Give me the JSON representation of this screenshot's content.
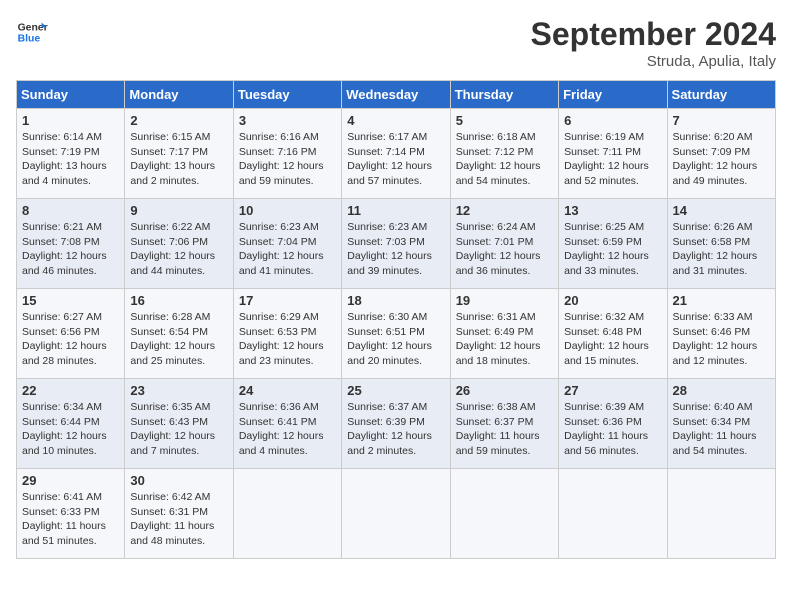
{
  "logo": {
    "text_general": "General",
    "text_blue": "Blue"
  },
  "header": {
    "month": "September 2024",
    "location": "Struda, Apulia, Italy"
  },
  "weekdays": [
    "Sunday",
    "Monday",
    "Tuesday",
    "Wednesday",
    "Thursday",
    "Friday",
    "Saturday"
  ],
  "weeks": [
    [
      {
        "day": "1",
        "info": "Sunrise: 6:14 AM\nSunset: 7:19 PM\nDaylight: 13 hours\nand 4 minutes."
      },
      {
        "day": "2",
        "info": "Sunrise: 6:15 AM\nSunset: 7:17 PM\nDaylight: 13 hours\nand 2 minutes."
      },
      {
        "day": "3",
        "info": "Sunrise: 6:16 AM\nSunset: 7:16 PM\nDaylight: 12 hours\nand 59 minutes."
      },
      {
        "day": "4",
        "info": "Sunrise: 6:17 AM\nSunset: 7:14 PM\nDaylight: 12 hours\nand 57 minutes."
      },
      {
        "day": "5",
        "info": "Sunrise: 6:18 AM\nSunset: 7:12 PM\nDaylight: 12 hours\nand 54 minutes."
      },
      {
        "day": "6",
        "info": "Sunrise: 6:19 AM\nSunset: 7:11 PM\nDaylight: 12 hours\nand 52 minutes."
      },
      {
        "day": "7",
        "info": "Sunrise: 6:20 AM\nSunset: 7:09 PM\nDaylight: 12 hours\nand 49 minutes."
      }
    ],
    [
      {
        "day": "8",
        "info": "Sunrise: 6:21 AM\nSunset: 7:08 PM\nDaylight: 12 hours\nand 46 minutes."
      },
      {
        "day": "9",
        "info": "Sunrise: 6:22 AM\nSunset: 7:06 PM\nDaylight: 12 hours\nand 44 minutes."
      },
      {
        "day": "10",
        "info": "Sunrise: 6:23 AM\nSunset: 7:04 PM\nDaylight: 12 hours\nand 41 minutes."
      },
      {
        "day": "11",
        "info": "Sunrise: 6:23 AM\nSunset: 7:03 PM\nDaylight: 12 hours\nand 39 minutes."
      },
      {
        "day": "12",
        "info": "Sunrise: 6:24 AM\nSunset: 7:01 PM\nDaylight: 12 hours\nand 36 minutes."
      },
      {
        "day": "13",
        "info": "Sunrise: 6:25 AM\nSunset: 6:59 PM\nDaylight: 12 hours\nand 33 minutes."
      },
      {
        "day": "14",
        "info": "Sunrise: 6:26 AM\nSunset: 6:58 PM\nDaylight: 12 hours\nand 31 minutes."
      }
    ],
    [
      {
        "day": "15",
        "info": "Sunrise: 6:27 AM\nSunset: 6:56 PM\nDaylight: 12 hours\nand 28 minutes."
      },
      {
        "day": "16",
        "info": "Sunrise: 6:28 AM\nSunset: 6:54 PM\nDaylight: 12 hours\nand 25 minutes."
      },
      {
        "day": "17",
        "info": "Sunrise: 6:29 AM\nSunset: 6:53 PM\nDaylight: 12 hours\nand 23 minutes."
      },
      {
        "day": "18",
        "info": "Sunrise: 6:30 AM\nSunset: 6:51 PM\nDaylight: 12 hours\nand 20 minutes."
      },
      {
        "day": "19",
        "info": "Sunrise: 6:31 AM\nSunset: 6:49 PM\nDaylight: 12 hours\nand 18 minutes."
      },
      {
        "day": "20",
        "info": "Sunrise: 6:32 AM\nSunset: 6:48 PM\nDaylight: 12 hours\nand 15 minutes."
      },
      {
        "day": "21",
        "info": "Sunrise: 6:33 AM\nSunset: 6:46 PM\nDaylight: 12 hours\nand 12 minutes."
      }
    ],
    [
      {
        "day": "22",
        "info": "Sunrise: 6:34 AM\nSunset: 6:44 PM\nDaylight: 12 hours\nand 10 minutes."
      },
      {
        "day": "23",
        "info": "Sunrise: 6:35 AM\nSunset: 6:43 PM\nDaylight: 12 hours\nand 7 minutes."
      },
      {
        "day": "24",
        "info": "Sunrise: 6:36 AM\nSunset: 6:41 PM\nDaylight: 12 hours\nand 4 minutes."
      },
      {
        "day": "25",
        "info": "Sunrise: 6:37 AM\nSunset: 6:39 PM\nDaylight: 12 hours\nand 2 minutes."
      },
      {
        "day": "26",
        "info": "Sunrise: 6:38 AM\nSunset: 6:37 PM\nDaylight: 11 hours\nand 59 minutes."
      },
      {
        "day": "27",
        "info": "Sunrise: 6:39 AM\nSunset: 6:36 PM\nDaylight: 11 hours\nand 56 minutes."
      },
      {
        "day": "28",
        "info": "Sunrise: 6:40 AM\nSunset: 6:34 PM\nDaylight: 11 hours\nand 54 minutes."
      }
    ],
    [
      {
        "day": "29",
        "info": "Sunrise: 6:41 AM\nSunset: 6:33 PM\nDaylight: 11 hours\nand 51 minutes."
      },
      {
        "day": "30",
        "info": "Sunrise: 6:42 AM\nSunset: 6:31 PM\nDaylight: 11 hours\nand 48 minutes."
      },
      {
        "day": "",
        "info": ""
      },
      {
        "day": "",
        "info": ""
      },
      {
        "day": "",
        "info": ""
      },
      {
        "day": "",
        "info": ""
      },
      {
        "day": "",
        "info": ""
      }
    ]
  ]
}
